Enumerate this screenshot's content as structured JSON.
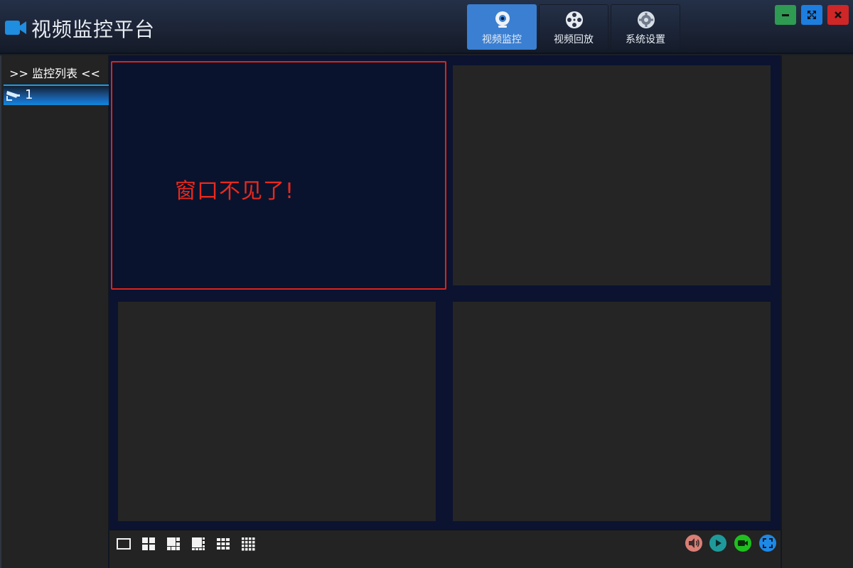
{
  "app": {
    "title": "视频监控平台"
  },
  "nav": [
    {
      "label": "视频监控",
      "icon": "webcam-icon",
      "active": true
    },
    {
      "label": "视频回放",
      "icon": "film-reel-icon",
      "active": false
    },
    {
      "label": "系统设置",
      "icon": "gear-icon",
      "active": false
    }
  ],
  "window_controls": [
    "minimize-icon",
    "maximize-icon",
    "close-icon"
  ],
  "sidebar": {
    "title": ">> 监控列表 <<",
    "items": [
      {
        "label": "1",
        "icon": "cctv-camera-icon"
      }
    ]
  },
  "video": {
    "selected_pane_note": "窗口不见了!",
    "pane_count": 4
  },
  "toolbar": {
    "layouts": [
      "layout-1-icon",
      "layout-4-icon",
      "layout-6-icon",
      "layout-8-icon",
      "layout-9-icon",
      "layout-16-icon"
    ],
    "controls": [
      "volume-icon",
      "play-icon",
      "record-icon",
      "fullscreen-icon"
    ]
  },
  "colors": {
    "accent": "#3a7fd2",
    "selected_border": "#e0221b",
    "minimize": "#2e9a52",
    "maximize": "#1d7ee0",
    "close": "#cf2627"
  }
}
